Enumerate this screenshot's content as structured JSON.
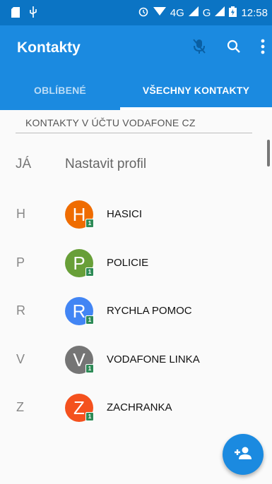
{
  "status_bar": {
    "time": "12:58",
    "network": "4G",
    "network2": "G",
    "icons": [
      "sd-card-icon",
      "usb-icon",
      "alarm-icon",
      "wifi-icon",
      "signal-icon",
      "signal2-icon",
      "battery-icon"
    ]
  },
  "app_bar": {
    "title": "Kontakty",
    "actions": [
      "mic-off-icon",
      "search-icon",
      "more-vert-icon"
    ]
  },
  "tabs": [
    {
      "label": "OBLÍBENÉ",
      "selected": false
    },
    {
      "label": "VŠECHNY KONTAKTY",
      "selected": true
    }
  ],
  "account_header": "KONTAKTY V ÚČTU VODAFONE CZ",
  "me": {
    "letter": "JÁ",
    "label": "Nastavit profil"
  },
  "contacts": [
    {
      "letter": "H",
      "initial": "H",
      "name": "HASICI",
      "color": "#ef6c00"
    },
    {
      "letter": "P",
      "initial": "P",
      "name": "POLICIE",
      "color": "#689f38"
    },
    {
      "letter": "R",
      "initial": "R",
      "name": "RYCHLA POMOC",
      "color": "#4285f4"
    },
    {
      "letter": "V",
      "initial": "V",
      "name": "VODAFONE LINKA",
      "color": "#757575"
    },
    {
      "letter": "Z",
      "initial": "Z",
      "name": "ZACHRANKA",
      "color": "#f4511e"
    }
  ],
  "badge": "1",
  "fab": {
    "icon": "add-person-icon"
  },
  "colors": {
    "primary": "#1b8ae0",
    "status_bar": "#0b74c4"
  }
}
